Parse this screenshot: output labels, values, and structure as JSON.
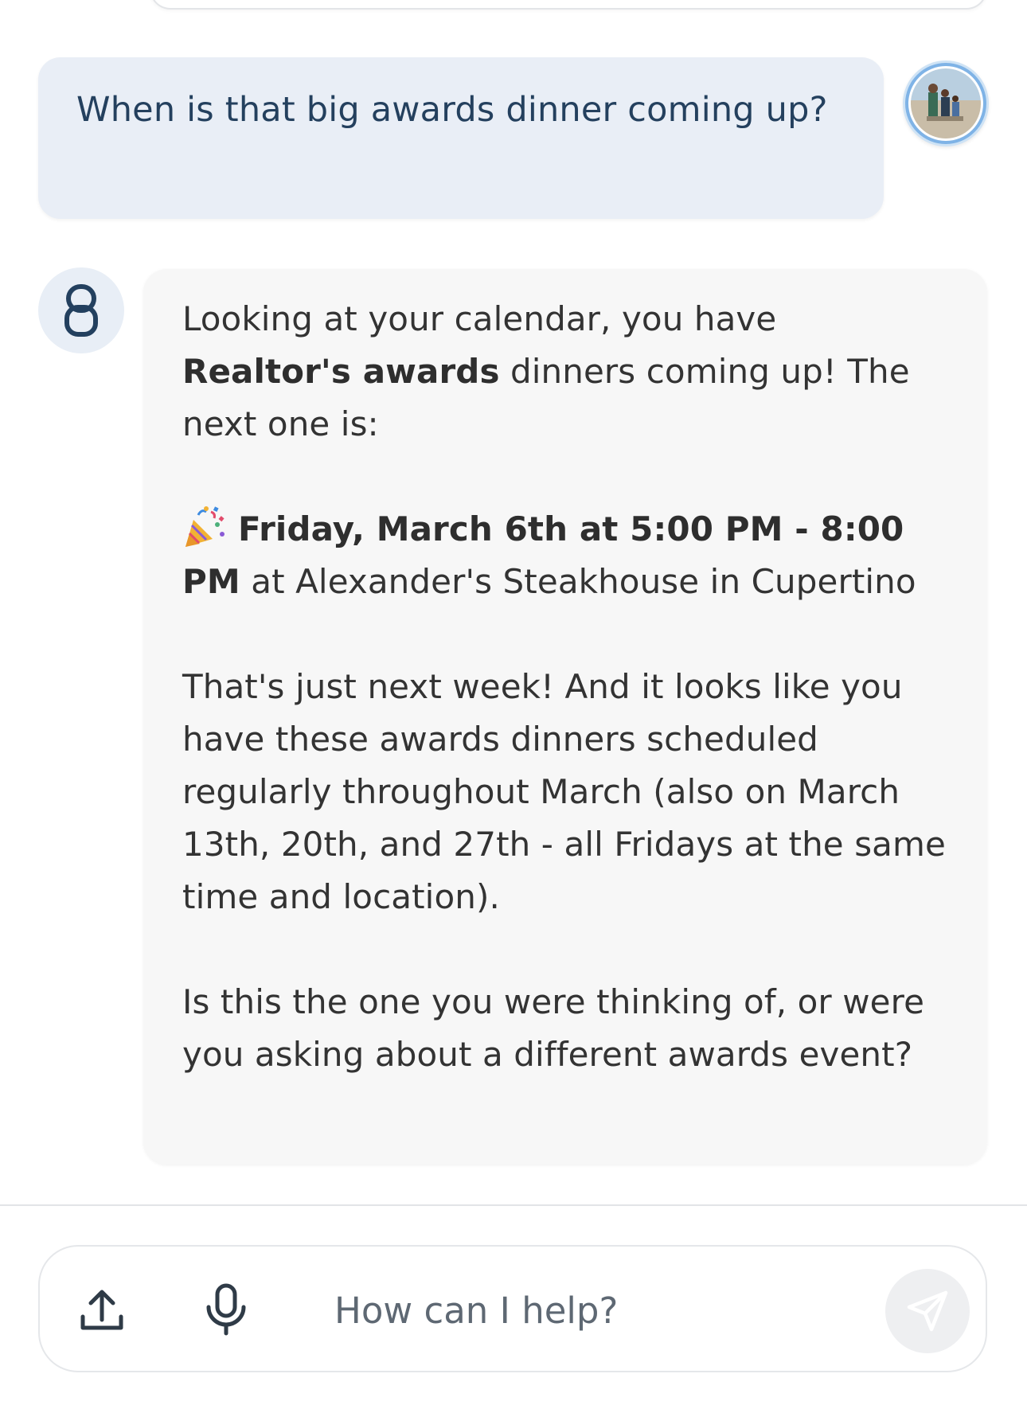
{
  "conversation": {
    "user_message": "When is that big awards dinner coming up?",
    "assistant": {
      "p1_a": "Looking at your calendar, you have ",
      "p1_bold": "Realtor's awards",
      "p1_b": " dinners coming up! The next one is:",
      "p2_bold": "Friday, March 6th at 5:00 PM - 8:00 PM",
      "p2_rest": " at Alexander's Steakhouse in Cupertino",
      "p3": "That's just next week! And it looks like you have these awards dinners scheduled regularly throughout March (also on March 13th, 20th, and 27th - all Fridays at the same time and location).",
      "p4": "Is this the one you were thinking of, or were you asking about a different awards event?"
    }
  },
  "composer": {
    "placeholder": "How can I help?"
  },
  "icons": {
    "upload": "upload-icon",
    "mic": "microphone-icon",
    "send": "send-icon",
    "party": "party-popper-icon",
    "bot": "assistant-logo-icon",
    "user_avatar": "user-avatar"
  },
  "colors": {
    "user_bubble": "#e9eef6",
    "user_text": "#24405e",
    "assistant_bubble": "#f7f7f7",
    "assistant_text": "#333333",
    "logo": "#23405f"
  }
}
